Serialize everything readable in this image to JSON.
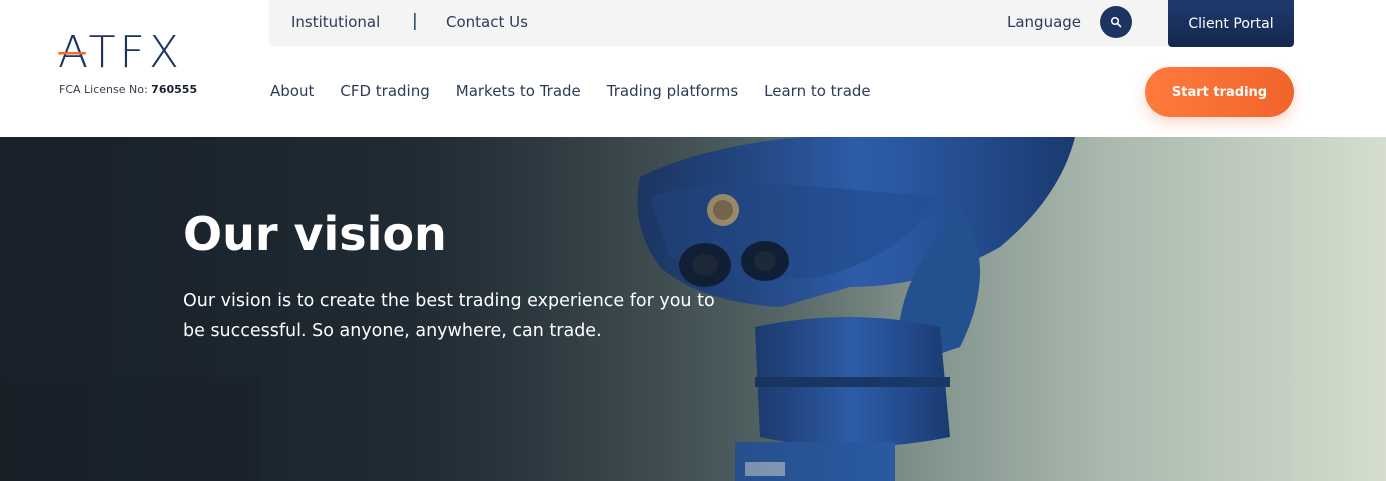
{
  "brand": {
    "logo_text": "ATFX",
    "license_label": "FCA License No:",
    "license_number": "760555",
    "accent_color": "#f26a2e",
    "navy_color": "#1d3461"
  },
  "topbar": {
    "institutional": "Institutional",
    "separator": "|",
    "contact": "Contact Us",
    "language": "Language",
    "search_icon": "search-icon",
    "client_portal": "Client Portal"
  },
  "nav": {
    "items": [
      "About",
      "CFD trading",
      "Markets to Trade",
      "Trading platforms",
      "Learn to trade"
    ]
  },
  "cta": {
    "start_trading": "Start trading"
  },
  "hero": {
    "title": "Our vision",
    "text": "Our vision is to create the best trading experience for you to be successful. So anyone, anywhere, can trade."
  }
}
